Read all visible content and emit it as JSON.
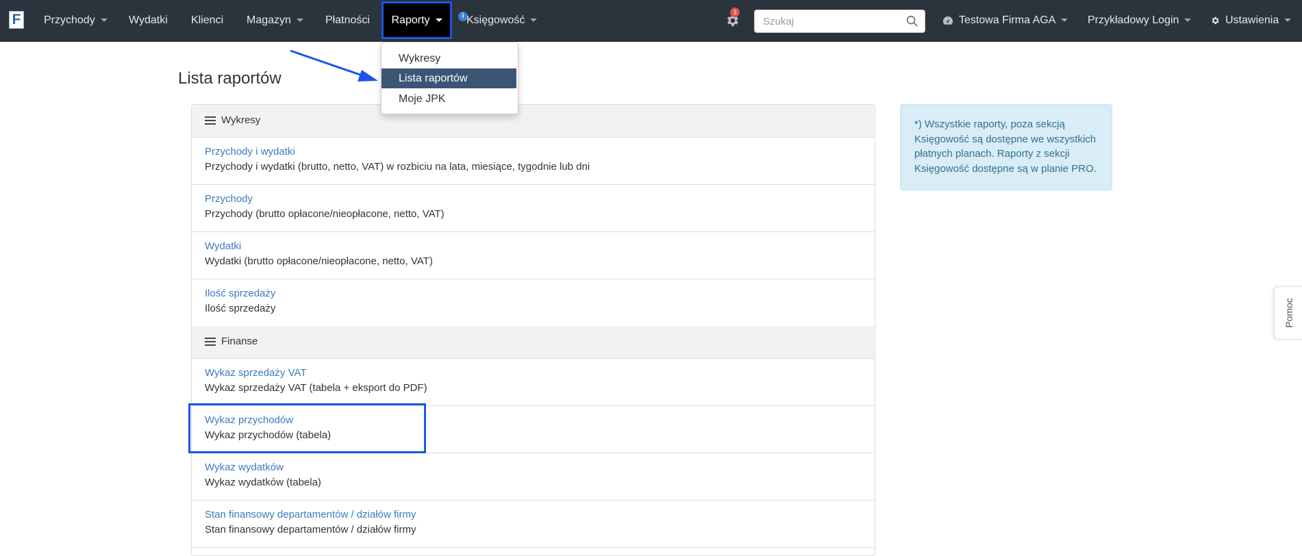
{
  "navbar": {
    "logo_letter": "F",
    "items": [
      {
        "label": "Przychody"
      },
      {
        "label": "Wydatki"
      },
      {
        "label": "Klienci"
      },
      {
        "label": "Magazyn"
      },
      {
        "label": "Płatności"
      },
      {
        "label": "Raporty"
      },
      {
        "label": "Księgowość"
      }
    ],
    "info_badge": "i",
    "notifications_count": "3",
    "search_placeholder": "Szukaj",
    "company": "Testowa Firma AGA",
    "user": "Przykładowy Login",
    "settings": "Ustawienia"
  },
  "dropdown": {
    "items": [
      {
        "label": "Wykresy"
      },
      {
        "label": "Lista raportów"
      },
      {
        "label": "Moje JPK"
      }
    ]
  },
  "page": {
    "title": "Lista raportów"
  },
  "sections": [
    {
      "title": "Wykresy",
      "reports": [
        {
          "link": "Przychody i wydatki",
          "desc": "Przychody i wydatki (brutto, netto, VAT) w rozbiciu na lata, miesiące, tygodnie lub dni"
        },
        {
          "link": "Przychody",
          "desc": "Przychody (brutto opłacone/nieopłacone, netto, VAT)"
        },
        {
          "link": "Wydatki",
          "desc": "Wydatki (brutto opłacone/nieopłacone, netto, VAT)"
        },
        {
          "link": "Ilość sprzedaży",
          "desc": "Ilość sprzedaży"
        }
      ]
    },
    {
      "title": "Finanse",
      "reports": [
        {
          "link": "Wykaz sprzedaży VAT",
          "desc": "Wykaz sprzedaży VAT (tabela + eksport do PDF)"
        },
        {
          "link": "Wykaz przychodów",
          "desc": "Wykaz przychodów (tabela)"
        },
        {
          "link": "Wykaz wydatków",
          "desc": "Wykaz wydatków (tabela)"
        },
        {
          "link": "Stan finansowy departamentów / działów firmy",
          "desc": "Stan finansowy departamentów / działów firmy"
        }
      ]
    }
  ],
  "info_alert": {
    "lines": [
      "*) Wszystkie raporty, poza sekcją",
      "Księgowość są dostępne we wszystkich",
      "płatnych planach. Raporty z sekcji",
      "Księgowość dostępne są w planie PRO."
    ]
  },
  "help_tab": "Pomoc",
  "colors": {
    "navbar_bg": "#2b333d",
    "link": "#3b7bbf",
    "highlight": "#1a56e6",
    "dropdown_active": "#3a5674",
    "alert_bg": "#d9edf7"
  }
}
